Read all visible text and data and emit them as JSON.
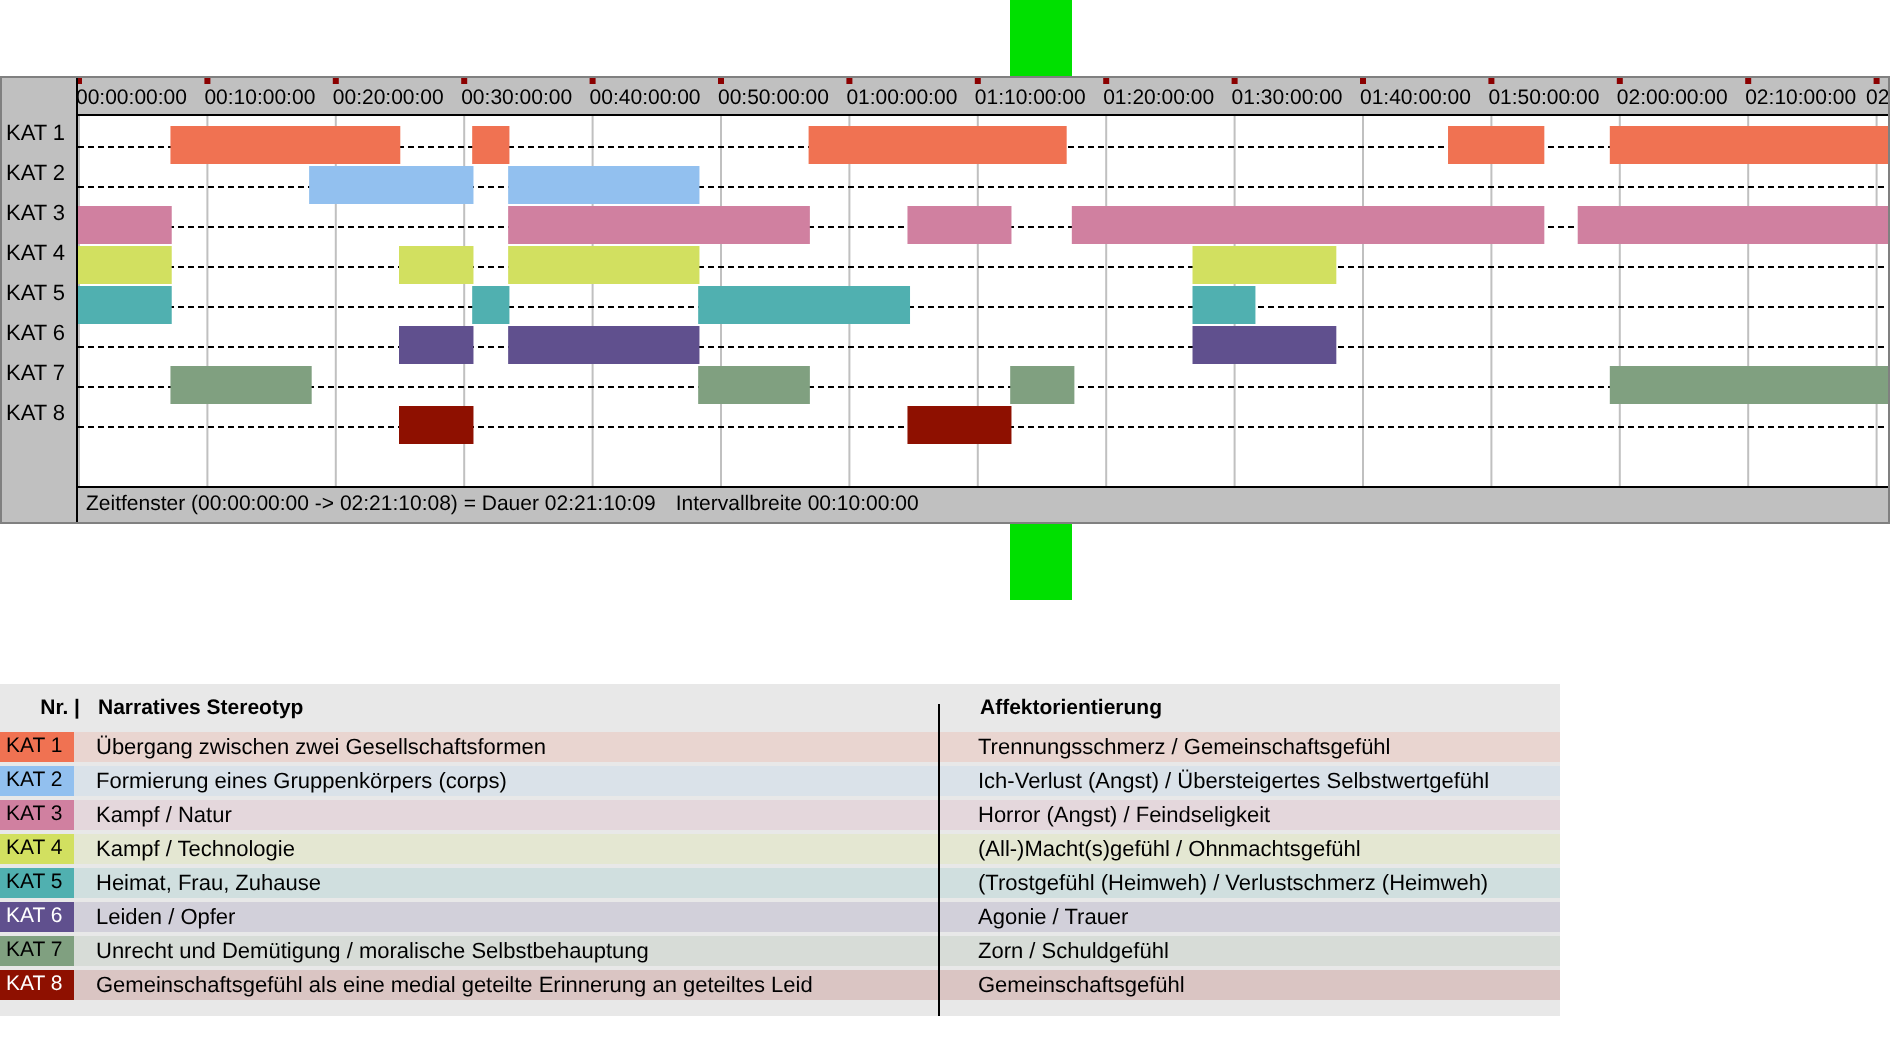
{
  "timeline": {
    "tick_labels": [
      "00:00:00:00",
      "00:10:00:00",
      "00:20:00:00",
      "00:30:00:00",
      "00:40:00:00",
      "00:50:00:00",
      "01:00:00:00",
      "01:10:00:00",
      "01:20:00:00",
      "01:30:00:00",
      "01:40:00:00",
      "01:50:00:00",
      "02:00:00:00",
      "02:10:00:00",
      "02"
    ],
    "rows": [
      {
        "label": "KAT 1",
        "color": "#f07252"
      },
      {
        "label": "KAT 2",
        "color": "#92c0ef"
      },
      {
        "label": "KAT 3",
        "color": "#d080a0"
      },
      {
        "label": "KAT 4",
        "color": "#d2e060"
      },
      {
        "label": "KAT 5",
        "color": "#50b0b0"
      },
      {
        "label": "KAT 6",
        "color": "#60508e"
      },
      {
        "label": "KAT 7",
        "color": "#80a080"
      },
      {
        "label": "KAT 8",
        "color": "#8e1000"
      }
    ],
    "status_bar": {
      "window": "Zeitfenster (00:00:00:00 -> 02:21:10:08) = Dauer 02:21:10:09",
      "interval": "Intervallbreite 00:10:00:00"
    }
  },
  "legend": {
    "columns": [
      "Nr. |",
      "Narratives Stereotyp",
      "Affektorientierung"
    ],
    "rows": [
      {
        "nr": "KAT 1",
        "color": "#f07252",
        "stereotype": "Übergang zwischen zwei Gesellschaftsformen",
        "affect": "Trennungsschmerz / Gemeinschaftsgefühl"
      },
      {
        "nr": "KAT 2",
        "color": "#92c0ef",
        "stereotype": "Formierung eines Gruppenkörpers (corps)",
        "affect": "Ich-Verlust (Angst) / Übersteigertes Selbstwertgefühl"
      },
      {
        "nr": "KAT 3",
        "color": "#d080a0",
        "stereotype": "Kampf / Natur",
        "affect": "Horror (Angst) / Feindseligkeit"
      },
      {
        "nr": "KAT 4",
        "color": "#d2e060",
        "stereotype": "Kampf / Technologie",
        "affect": "(All-)Macht(s)gefühl / Ohnmachtsgefühl"
      },
      {
        "nr": "KAT 5",
        "color": "#50b0b0",
        "stereotype": "Heimat, Frau, Zuhause",
        "affect": "(Trostgefühl (Heimweh) / Verlustschmerz (Heimweh)"
      },
      {
        "nr": "KAT 6",
        "color": "#60508e",
        "stereotype": "Leiden / Opfer",
        "affect": "Agonie / Trauer"
      },
      {
        "nr": "KAT 7",
        "color": "#80a080",
        "stereotype": "Unrecht und Demütigung / moralische Selbstbehauptung",
        "affect": "Zorn / Schuldgefühl"
      },
      {
        "nr": "KAT 8",
        "color": "#8e1000",
        "stereotype": "Gemeinschaftsgefühl als eine medial geteilte Erinnerung an geteiltes Leid",
        "affect": "Gemeinschaftsgefühl"
      }
    ]
  }
}
